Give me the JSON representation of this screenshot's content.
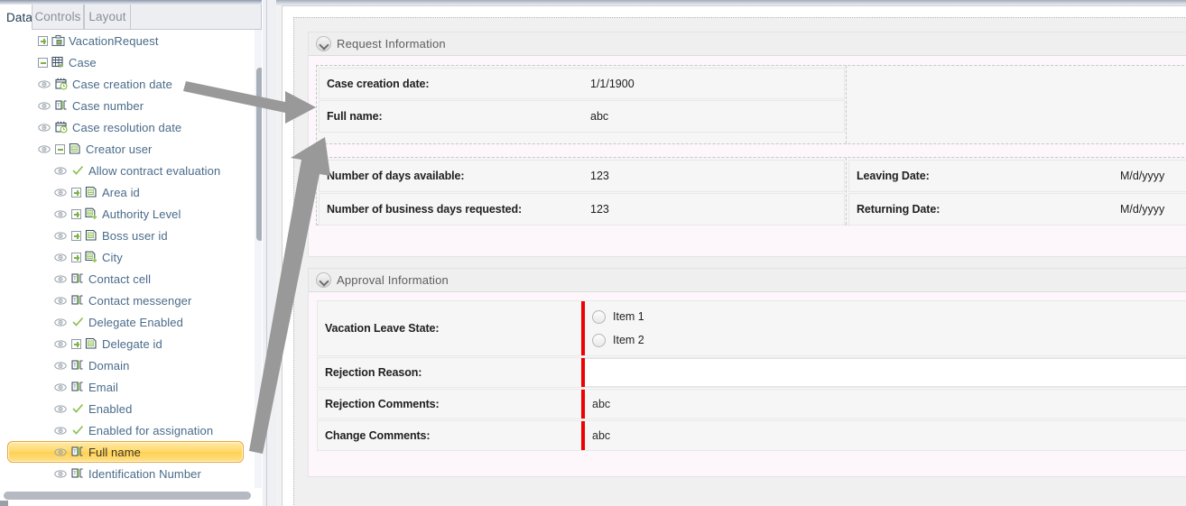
{
  "tabs": [
    {
      "label": "Data",
      "active": true
    },
    {
      "label": "Controls",
      "active": false
    },
    {
      "label": "Layout",
      "active": false
    }
  ],
  "tree": [
    {
      "label": "VacationRequest",
      "depth": 0,
      "expander": "plus",
      "eye": false,
      "icon": "briefcase-icon"
    },
    {
      "label": "Case",
      "depth": 0,
      "expander": "minus",
      "eye": false,
      "icon": "table-play-icon"
    },
    {
      "label": "Case creation date",
      "depth": 1,
      "expander": "none",
      "eye": true,
      "icon": "date-icon"
    },
    {
      "label": "Case number",
      "depth": 1,
      "expander": "none",
      "eye": true,
      "icon": "text-icon"
    },
    {
      "label": "Case resolution date",
      "depth": 1,
      "expander": "none",
      "eye": true,
      "icon": "date-icon"
    },
    {
      "label": "Creator user",
      "depth": 1,
      "expander": "minus",
      "eye": true,
      "icon": "entity-icon"
    },
    {
      "label": "Allow contract evaluation",
      "depth": 2,
      "expander": "none",
      "eye": true,
      "icon": "check-icon"
    },
    {
      "label": "Area id",
      "depth": 2,
      "expander": "plus",
      "eye": true,
      "icon": "entity-icon"
    },
    {
      "label": "Authority Level",
      "depth": 2,
      "expander": "plus",
      "eye": true,
      "icon": "entity-plus-icon"
    },
    {
      "label": "Boss user id",
      "depth": 2,
      "expander": "plus",
      "eye": true,
      "icon": "entity-icon"
    },
    {
      "label": "City",
      "depth": 2,
      "expander": "plus",
      "eye": true,
      "icon": "entity-plus-icon"
    },
    {
      "label": "Contact cell",
      "depth": 2,
      "expander": "none",
      "eye": true,
      "icon": "text-icon"
    },
    {
      "label": "Contact messenger",
      "depth": 2,
      "expander": "none",
      "eye": true,
      "icon": "text-icon"
    },
    {
      "label": "Delegate Enabled",
      "depth": 2,
      "expander": "none",
      "eye": true,
      "icon": "check-icon"
    },
    {
      "label": "Delegate id",
      "depth": 2,
      "expander": "plus",
      "eye": true,
      "icon": "entity-icon"
    },
    {
      "label": "Domain",
      "depth": 2,
      "expander": "none",
      "eye": true,
      "icon": "text-icon"
    },
    {
      "label": "Email",
      "depth": 2,
      "expander": "none",
      "eye": true,
      "icon": "text-icon"
    },
    {
      "label": "Enabled",
      "depth": 2,
      "expander": "none",
      "eye": true,
      "icon": "check-icon"
    },
    {
      "label": "Enabled for assignation",
      "depth": 2,
      "expander": "none",
      "eye": true,
      "icon": "check-icon"
    },
    {
      "label": "Full name",
      "depth": 2,
      "expander": "none",
      "eye": true,
      "icon": "text-icon",
      "selected": true
    },
    {
      "label": "Identification Number",
      "depth": 2,
      "expander": "none",
      "eye": true,
      "icon": "text-icon"
    }
  ],
  "form": {
    "sections": [
      {
        "title": "Request Information",
        "rows_top": [
          {
            "label": "Case creation date:",
            "value": "1/1/1900"
          },
          {
            "label": "Full name:",
            "value": "abc"
          }
        ],
        "rows_bottom_left": [
          {
            "label": "Number of days available:",
            "value": "123"
          },
          {
            "label": "Number of business days requested:",
            "value": "123"
          }
        ],
        "rows_bottom_right": [
          {
            "label": "Leaving Date:",
            "value": "M/d/yyyy"
          },
          {
            "label": "Returning Date:",
            "value": "M/d/yyyy"
          }
        ]
      },
      {
        "title": "Approval Information",
        "rows": [
          {
            "label": "Vacation Leave State:",
            "type": "radiogroup",
            "required": true,
            "options": [
              "Item 1",
              "Item 2"
            ]
          },
          {
            "label": "Rejection Reason:",
            "type": "input",
            "required": true,
            "value": ""
          },
          {
            "label": "Rejection Comments:",
            "type": "textgrey",
            "required": true,
            "value": "abc"
          },
          {
            "label": "Change Comments:",
            "type": "textgrey",
            "required": true,
            "value": "abc"
          }
        ]
      }
    ]
  },
  "colors": {
    "required_marker": "#ee0000",
    "selection_fill": "#ffd96b",
    "selection_border": "#e8a640",
    "tree_text": "#4a6b8a",
    "arrow": "#999999",
    "section_bg": "#fdf7fb"
  },
  "annotations": {
    "arrow1_name": "arrow-to-case-creation-date",
    "arrow2_name": "arrow-from-full-name-tree-node"
  }
}
